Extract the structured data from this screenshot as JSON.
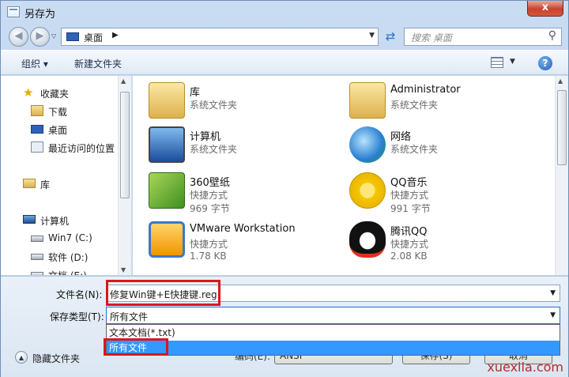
{
  "window": {
    "title": "另存为",
    "close_label": "x"
  },
  "address": {
    "location": "桌面",
    "search_placeholder": "搜索 桌面"
  },
  "toolbar": {
    "organize": "组织 ▾",
    "new_folder": "新建文件夹"
  },
  "nav": {
    "items": [
      {
        "label": "收藏夹",
        "icon": "star-icon"
      },
      {
        "label": "下载",
        "icon": "download-folder-icon"
      },
      {
        "label": "桌面",
        "icon": "desktop-icon"
      },
      {
        "label": "最近访问的位置",
        "icon": "recent-places-icon"
      },
      {
        "label": "库",
        "icon": "library-icon"
      },
      {
        "label": "计算机",
        "icon": "computer-icon"
      },
      {
        "label": "Win7 (C:)",
        "icon": "drive-icon"
      },
      {
        "label": "软件 (D:)",
        "icon": "drive-icon"
      },
      {
        "label": "文档 (E:)",
        "icon": "drive-icon"
      }
    ]
  },
  "files": [
    {
      "name": "库",
      "sub1": "系统文件夹",
      "sub2": "",
      "icon": "library-folder-icon"
    },
    {
      "name": "Administrator",
      "sub1": "系统文件夹",
      "sub2": "",
      "icon": "user-folder-icon"
    },
    {
      "name": "计算机",
      "sub1": "系统文件夹",
      "sub2": "",
      "icon": "computer-icon"
    },
    {
      "name": "网络",
      "sub1": "系统文件夹",
      "sub2": "",
      "icon": "network-icon"
    },
    {
      "name": "360壁纸",
      "sub1": "快捷方式",
      "sub2": "969 字节",
      "icon": "wallpaper-app-icon"
    },
    {
      "name": "QQ音乐",
      "sub1": "快捷方式",
      "sub2": "991 字节",
      "icon": "qq-music-icon"
    },
    {
      "name": "VMware Workstation",
      "sub1": "快捷方式",
      "sub2": "1.78 KB",
      "icon": "vmware-icon"
    },
    {
      "name": "腾讯QQ",
      "sub1": "快捷方式",
      "sub2": "2.08 KB",
      "icon": "qq-penguin-icon"
    }
  ],
  "form": {
    "filename_label": "文件名(N):",
    "filename_value": "修复Win键+E快捷键.reg",
    "filetype_label": "保存类型(T):",
    "filetype_value": "所有文件",
    "options": [
      "文本文档(*.txt)",
      "所有文件"
    ],
    "hide_folders": "隐藏文件夹",
    "encoding_label": "编码(E):",
    "encoding_value": "ANSI",
    "save": "保存(S)",
    "cancel": "取消"
  },
  "watermark": "xuexila.com",
  "colors": {
    "highlight_box": "#d9171c",
    "selected_option": "#3399ff",
    "close_button": "#c7432b"
  }
}
